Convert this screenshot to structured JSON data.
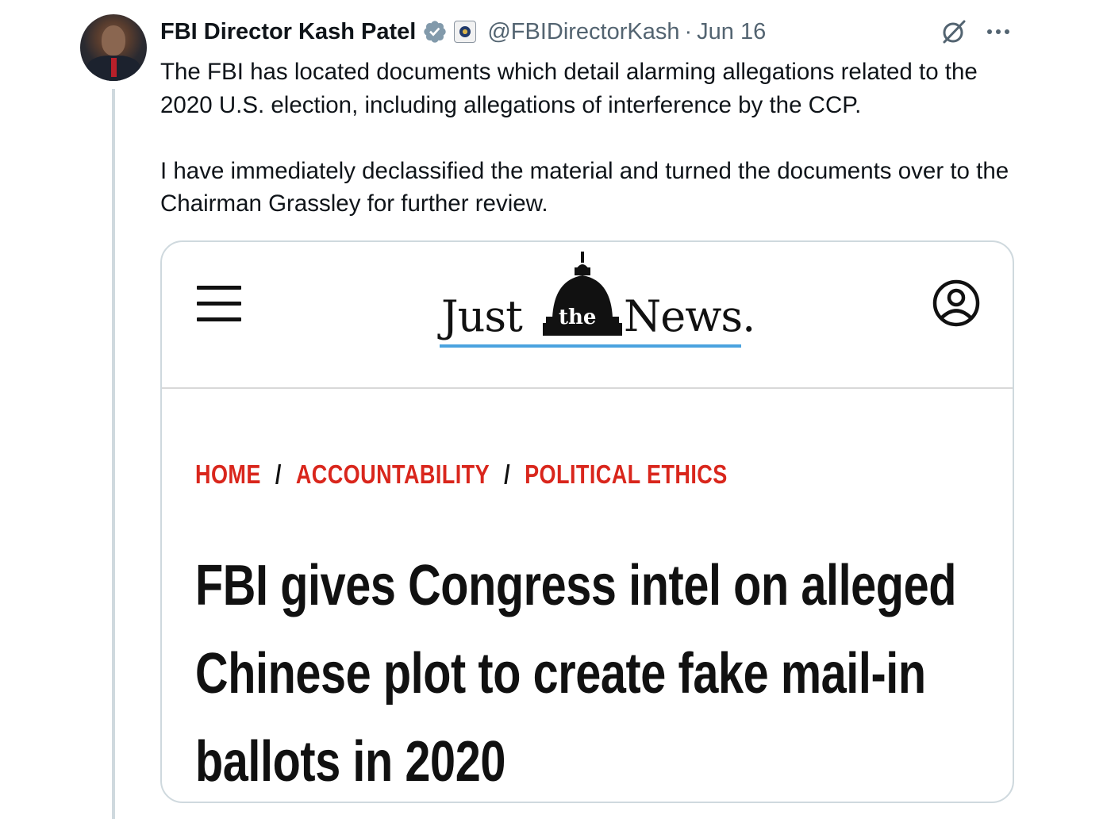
{
  "tweet": {
    "display_name": "FBI Director Kash Patel",
    "handle": "@FBIDirectorKash",
    "separator": "·",
    "date": "Jun 16",
    "paragraphs": [
      "The FBI has located documents which detail alarming allegations related to the 2020 U.S. election, including allegations of interference by the CCP.",
      "I have immediately declassified the material and turned the documents over to the Chairman Grassley for further review."
    ],
    "icons": {
      "verified": "verified-badge-icon",
      "affiliate": "fbi-seal-icon",
      "grok": "grok-icon",
      "more": "more-options-icon"
    },
    "colors": {
      "verified": "#829aab",
      "secondary_text": "#536471"
    }
  },
  "card": {
    "site": {
      "logo_word_1": "Just",
      "logo_the": "the",
      "logo_word_2": "News.",
      "menu_icon": "hamburger-menu-icon",
      "account_icon": "user-profile-icon"
    },
    "breadcrumb": {
      "items": [
        "HOME",
        "ACCOUNTABILITY",
        "POLITICAL ETHICS"
      ],
      "separator": "/",
      "color": "#d9261c"
    },
    "headline": "FBI gives Congress intel on alleged Chinese plot to create fake mail-in ballots in 2020"
  }
}
